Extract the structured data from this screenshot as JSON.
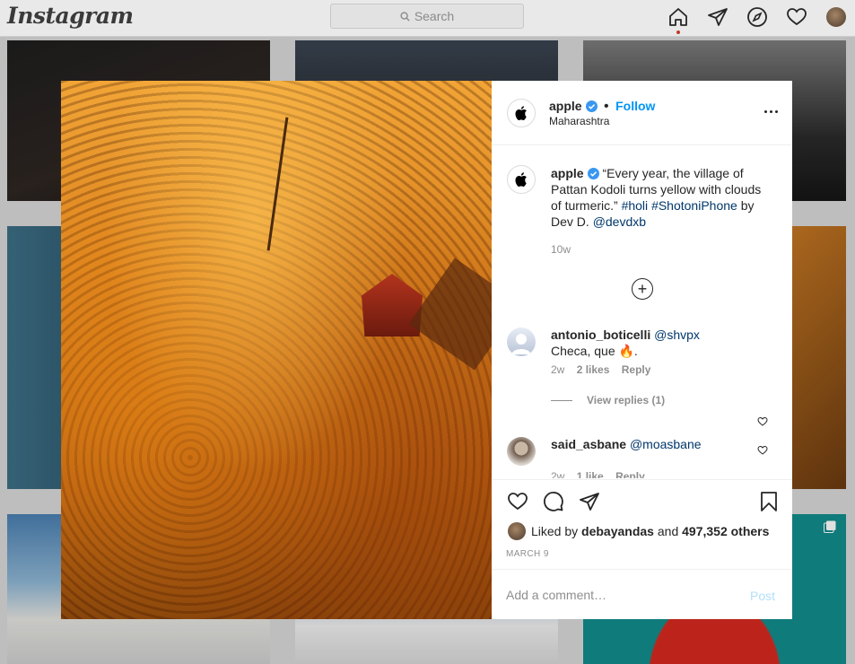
{
  "topbar": {
    "logo": "Instagram",
    "search_placeholder": "Search"
  },
  "post": {
    "author": "apple",
    "follow_label": "Follow",
    "separator": "•",
    "location": "Maharashtra",
    "caption": {
      "username": "apple",
      "text": "“Every year, the village of Pattan Kodoli turns yellow with clouds of turmeric.”",
      "hashtag1": "#holi",
      "hashtag2": "#ShotoniPhone",
      "by_text": "by Dev D.",
      "mention": "@devdxb",
      "time": "10w"
    },
    "comments": [
      {
        "username": "antonio_boticelli",
        "mention": "@shvpx",
        "text": "Checa, que 🔥.",
        "time": "2w",
        "likes": "2 likes",
        "reply": "Reply",
        "view_replies": "View replies (1)"
      },
      {
        "username": "said_asbane",
        "mention": "@moasbane",
        "time": "2w",
        "likes": "1 like",
        "reply": "Reply"
      }
    ],
    "liked_by_prefix": "Liked by",
    "liked_by_user": "debayandas",
    "liked_by_and": "and",
    "liked_by_count": "497,352 others",
    "date": "MARCH 9",
    "comment_placeholder": "Add a comment…",
    "post_label": "Post"
  },
  "colors": {
    "accent": "#0095f6",
    "link": "#00376b",
    "post_disabled": "#b2dffc"
  }
}
